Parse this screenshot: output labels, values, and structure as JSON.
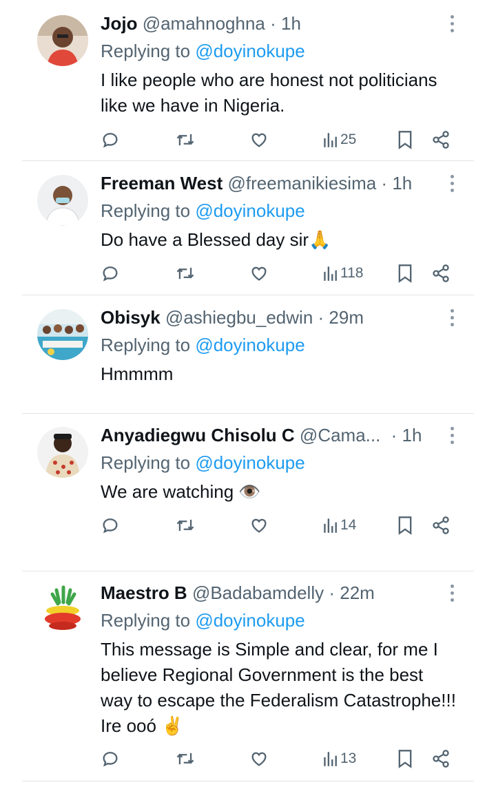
{
  "reply_prefix": "Replying to",
  "tweets": [
    {
      "name": "Jojo",
      "handle": "@amahnoghna",
      "sep": "·",
      "time": "1h",
      "replying_to": "@doyinokupe",
      "text": "I like people who are honest not politicians like we have in Nigeria.",
      "views": "25",
      "avatar": "avatar-man-red-shirt"
    },
    {
      "name": "Freeman West",
      "handle": "@freemanikiesima",
      "sep": "·",
      "time": "1h",
      "replying_to": "@doyinokupe",
      "text": "Do have a Blessed day sir🙏",
      "views": "118",
      "avatar": "avatar-man-face-mask"
    },
    {
      "name": "Obisyk",
      "handle": "@ashiegbu_edwin",
      "sep": "·",
      "time": "29m",
      "replying_to": "@doyinokupe",
      "text": "Hmmmm",
      "views": "",
      "avatar": "avatar-crowd-event"
    },
    {
      "name": "Anyadiegwu Chisolu C",
      "handle": "@Cama...",
      "sep": "·",
      "time": "1h",
      "replying_to": "@doyinokupe",
      "text": "We are watching 👁️",
      "views": "14",
      "avatar": "avatar-man-traditional-attire"
    },
    {
      "name": "Maestro B",
      "handle": "@Badabamdelly",
      "sep": "·",
      "time": "22m",
      "replying_to": "@doyinokupe",
      "text": "This message is Simple and clear, for me I believe Regional Government is the best way to escape the Federalism Catastrophe!!! Ire oоó ✌️",
      "views": "13",
      "avatar": "avatar-plant-logo"
    }
  ],
  "icons": [
    "reply-icon",
    "retweet-icon",
    "like-icon",
    "views-icon",
    "bookmark-icon",
    "share-icon",
    "more-options-icon"
  ],
  "colors": {
    "link": "#1d9bf0",
    "muted": "#536471",
    "text": "#0f1419",
    "divider": "#dfe3e6"
  }
}
